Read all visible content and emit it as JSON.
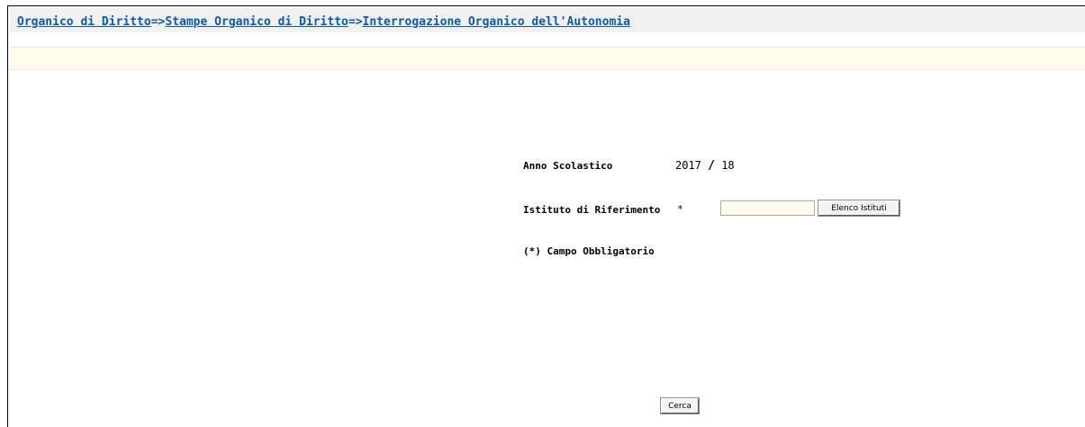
{
  "breadcrumb": {
    "item1": "Organico di Diritto",
    "item2": "Stampe Organico di Diritto",
    "item3": "Interrogazione Organico dell'Autonomia",
    "separator": "=>"
  },
  "form": {
    "anno_label": "Anno Scolastico",
    "anno_start": "2017",
    "anno_sep": "/",
    "anno_end": "18",
    "istituto_label": "Istituto di Riferimento",
    "required_marker": "*",
    "istituto_value": "",
    "elenco_button": "Elenco Istituti",
    "required_note": "(*) Campo Obbligatorio",
    "cerca_button": "Cerca"
  }
}
